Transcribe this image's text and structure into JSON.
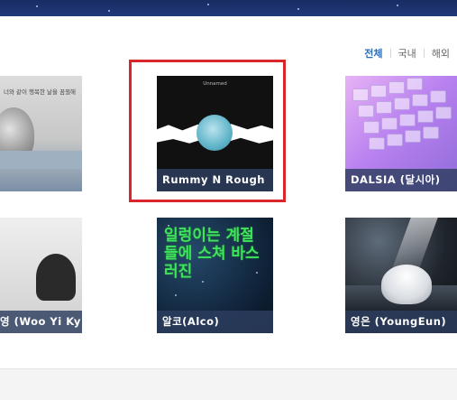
{
  "filter_tabs": [
    {
      "label": "전체",
      "active": true
    },
    {
      "label": "국내",
      "active": false
    },
    {
      "label": "해외",
      "active": false
    }
  ],
  "artists": [
    {
      "name": "",
      "cover_text": "너와 같이 행복한 날을 꿈꿨해"
    },
    {
      "name": "Rummy N Rough",
      "cover_text": "Unnamed"
    },
    {
      "name": "DALSIA (달시아)",
      "cover_text": ""
    },
    {
      "name": "영 (Woo Yi Ky",
      "cover_text": ""
    },
    {
      "name": "알코(Alco)",
      "cover_text": "일렁이는 계절들에 스쳐 바스러진"
    },
    {
      "name": "영은 (YoungEun)",
      "cover_text": ""
    }
  ],
  "highlight_color": "#d9262b",
  "caption_color": "#2d3e5f",
  "active_tab_color": "#2a6ebb"
}
